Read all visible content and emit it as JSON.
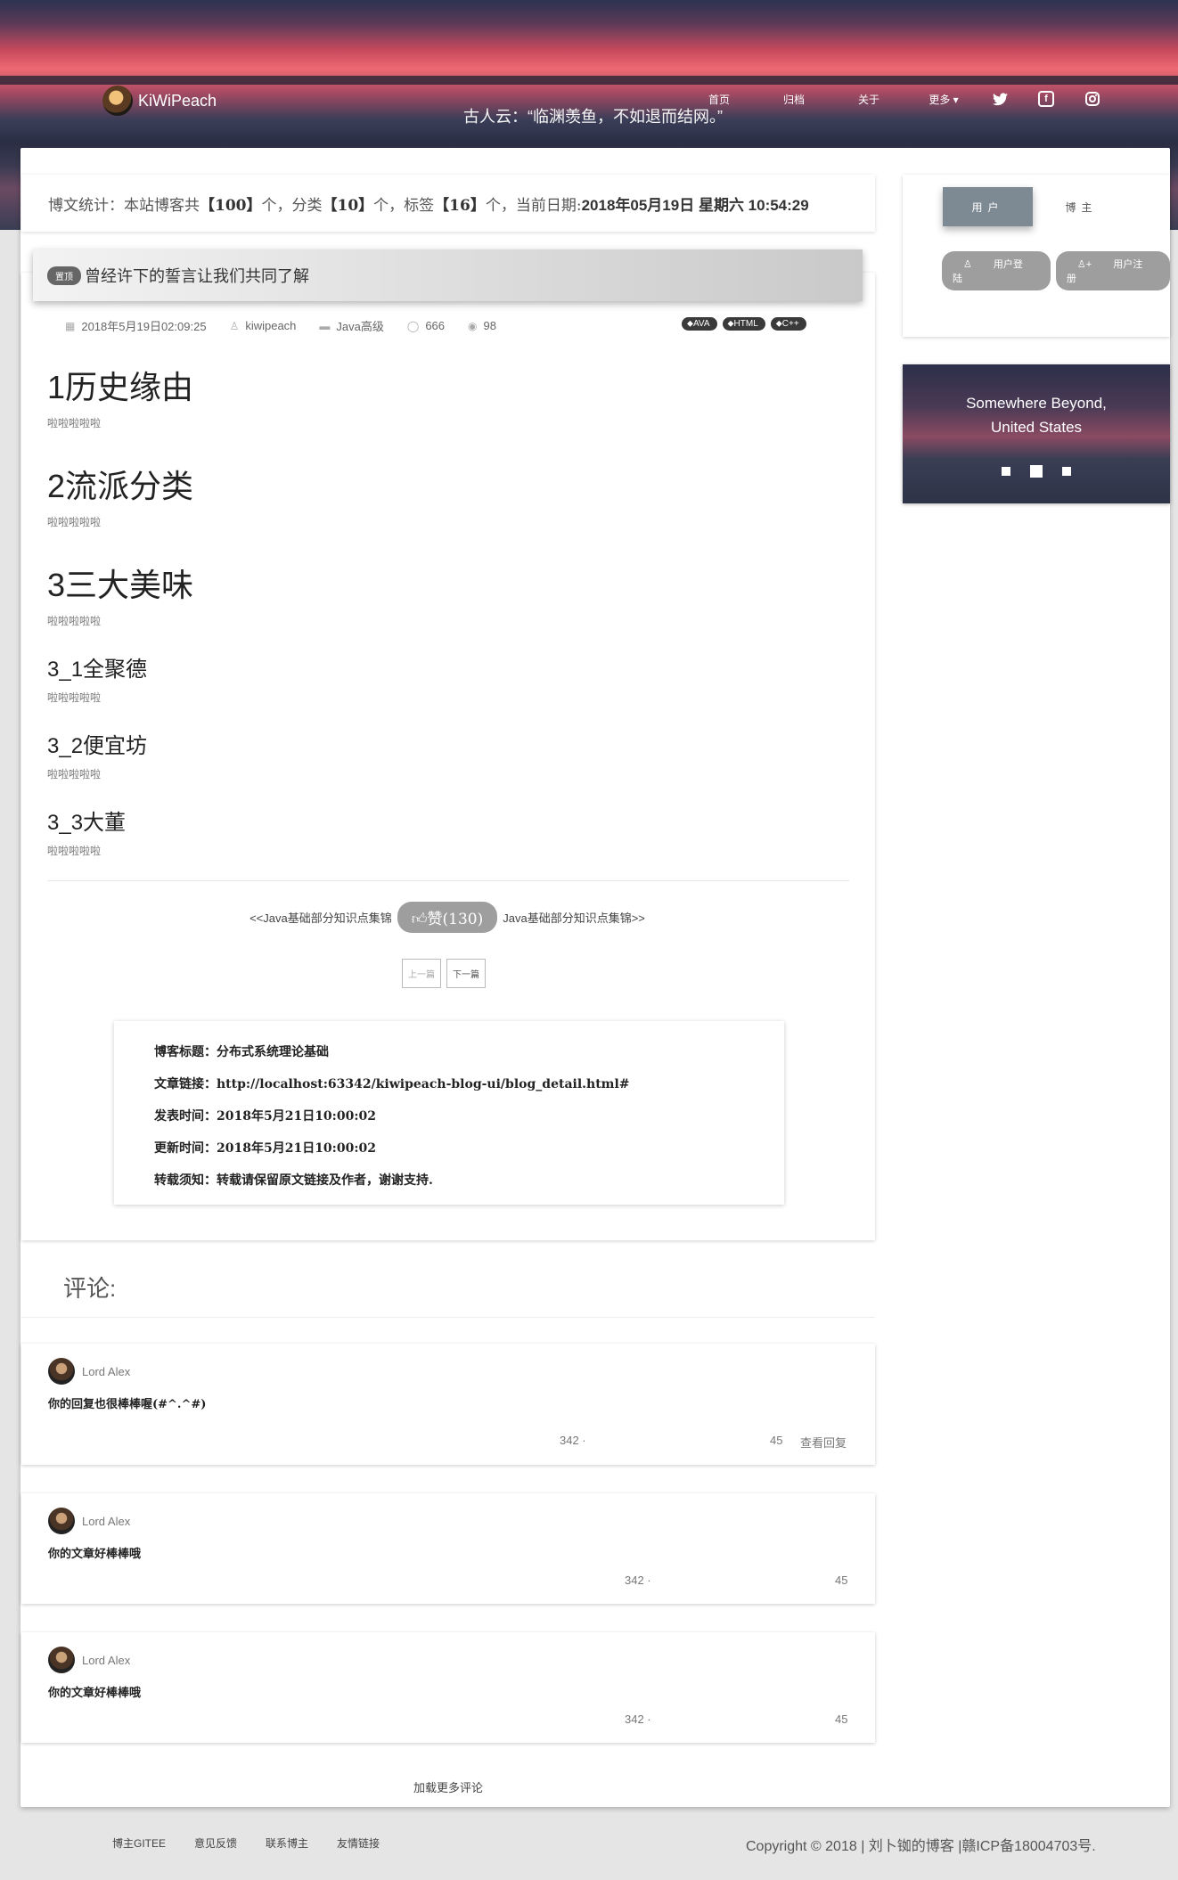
{
  "header": {
    "brand": "KiWiPeach",
    "motto": "古人云：“临渊羡鱼，不如退而结网。”",
    "nav": [
      "首页",
      "归档",
      "关于",
      "更多 ▾"
    ],
    "social_icons": [
      "twitter-icon",
      "facebook-icon",
      "instagram-icon"
    ]
  },
  "stats": {
    "prefix": "博文统计：本站博客共",
    "blogs": "【100】",
    "mid1": "个，分类",
    "categories": "【10】",
    "mid2": "个，标签",
    "tags": "【16】",
    "mid3": "个，当前日期:",
    "date": "2018年05月19日 星期六 10:54:29"
  },
  "article": {
    "pill": "置顶",
    "title": "曾经许下的誓言让我们共同了解",
    "meta": {
      "date": "2018年5月19日02:09:25",
      "author": "kiwipeach",
      "category": "Java高级",
      "comments": "666",
      "views": "98"
    },
    "tags": [
      "AVA",
      "HTML",
      "C++"
    ],
    "sections": [
      {
        "h": "1历史缘由",
        "p": "啦啦啦啦啦"
      },
      {
        "h": "2流派分类",
        "p": "啦啦啦啦啦"
      },
      {
        "h": "3三大美味",
        "p": "啦啦啦啦啦"
      },
      {
        "h": "3_1全聚德",
        "p": "啦啦啦啦啦"
      },
      {
        "h": "3_2便宜坊",
        "p": "啦啦啦啦啦"
      },
      {
        "h": "3_3大董",
        "p": "啦啦啦啦啦"
      }
    ],
    "prev_link": "<<Java基础部分知识点集锦",
    "like": "赞(130)",
    "next_link": "Java基础部分知识点集锦>>",
    "prev_btn": "上一篇",
    "next_btn": "下一篇"
  },
  "info": {
    "rows": [
      {
        "label": "博客标题：",
        "value": "分布式系统理论基础"
      },
      {
        "label": "文章链接：",
        "value": "http://localhost:63342/kiwipeach-blog-ui/blog_detail.html#"
      },
      {
        "label": "发表时间：",
        "value": "2018年5月21日10:00:02"
      },
      {
        "label": "更新时间：",
        "value": "2018年5月21日10:00:02"
      },
      {
        "label": "转载须知：",
        "value": "转载请保留原文链接及作者，谢谢支持."
      }
    ]
  },
  "comments": {
    "title": "评论:",
    "items": [
      {
        "user": "Lord Alex",
        "text": "你的回复也很棒棒喔(#^.^#)",
        "likes": "342 ·",
        "replies": "45",
        "view_replies": "查看回复"
      },
      {
        "user": "Lord Alex",
        "text": "你的文章好棒棒哦",
        "likes": "342 ·",
        "replies": "45"
      },
      {
        "user": "Lord Alex",
        "text": "你的文章好棒棒哦",
        "likes": "342 ·",
        "replies": "45"
      }
    ],
    "load_more": "加载更多评论"
  },
  "sidebar": {
    "tab_user": "用户",
    "tab_blogger": "博主",
    "login": "用户登陆",
    "register": "用户注册",
    "carousel_caption_1": "Somewhere Beyond,",
    "carousel_caption_2": "United States"
  },
  "footer": {
    "links": [
      "博主GITEE",
      "意见反馈",
      "联系博主",
      "友情链接"
    ],
    "copyright": "Copyright © 2018 | 刘卜铷的博客 |赣ICP备18004703号."
  }
}
